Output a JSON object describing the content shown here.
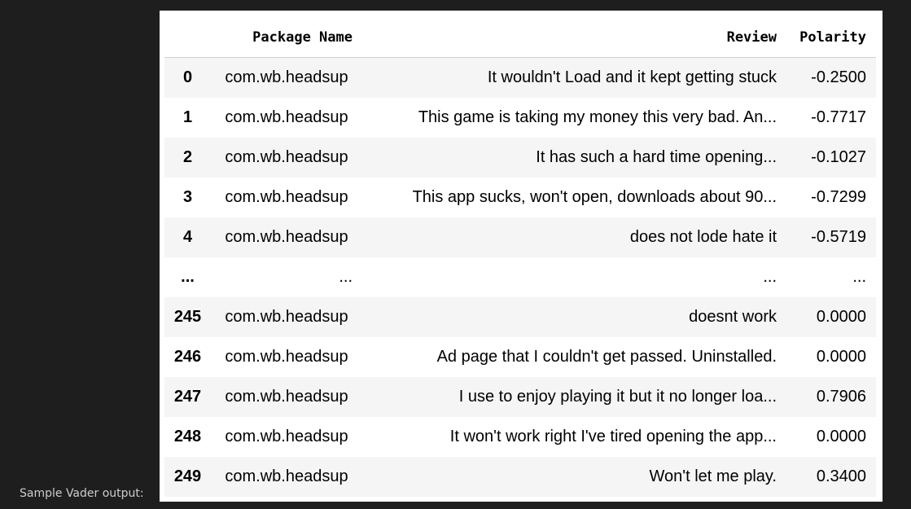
{
  "caption": "Sample Vader output:",
  "table": {
    "columns": [
      "",
      "Package Name",
      "Review",
      "Polarity"
    ],
    "rows": [
      {
        "index": "0",
        "package": "com.wb.headsup",
        "review": "It wouldn't Load and it kept getting stuck",
        "polarity": "-0.2500"
      },
      {
        "index": "1",
        "package": "com.wb.headsup",
        "review": "This game is taking my money this very bad. An...",
        "polarity": "-0.7717"
      },
      {
        "index": "2",
        "package": "com.wb.headsup",
        "review": "It has such a hard time opening...",
        "polarity": "-0.1027"
      },
      {
        "index": "3",
        "package": "com.wb.headsup",
        "review": "This app sucks, won't open, downloads about 90...",
        "polarity": "-0.7299"
      },
      {
        "index": "4",
        "package": "com.wb.headsup",
        "review": "does not lode hate it",
        "polarity": "-0.5719"
      },
      {
        "index": "...",
        "package": "...",
        "review": "...",
        "polarity": "..."
      },
      {
        "index": "245",
        "package": "com.wb.headsup",
        "review": "doesnt work",
        "polarity": "0.0000"
      },
      {
        "index": "246",
        "package": "com.wb.headsup",
        "review": "Ad page that I couldn't get passed. Uninstalled.",
        "polarity": "0.0000"
      },
      {
        "index": "247",
        "package": "com.wb.headsup",
        "review": "I use to enjoy playing it but it no longer loa...",
        "polarity": "0.7906"
      },
      {
        "index": "248",
        "package": "com.wb.headsup",
        "review": "It won't work right I've tired opening the app...",
        "polarity": "0.0000"
      },
      {
        "index": "249",
        "package": "com.wb.headsup",
        "review": "Won't let me play.",
        "polarity": "0.3400"
      }
    ]
  }
}
